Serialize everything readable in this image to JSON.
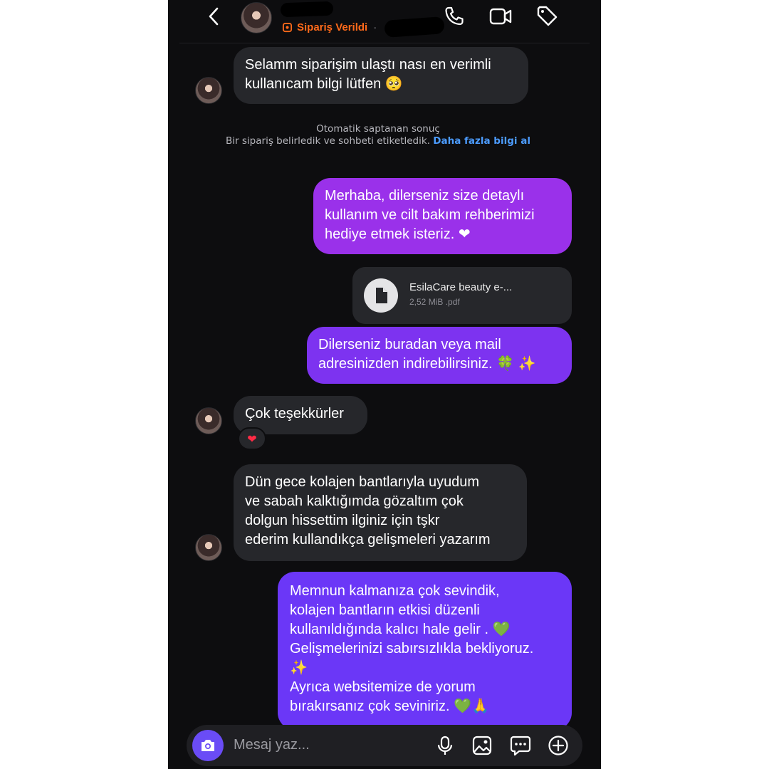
{
  "header": {
    "order_status": "Sipariş Verildi",
    "separator": "·"
  },
  "messages": [
    {
      "sender": "customer",
      "text": "Selamm siparişim ulaştı nası en verimli\nkullanıcam bilgi lütfen 🥺"
    },
    {
      "sender": "shop",
      "text": "Merhaba, dilerseniz size detaylı\nkullanım ve cilt bakım rehberimizi\nhediye etmek isteriz. ❤"
    },
    {
      "sender": "shop",
      "text": "Dilerseniz buradan veya mail\nadresinizden indirebilirsiniz. 🍀 ✨"
    },
    {
      "sender": "customer",
      "text": "Çok teşekkürler"
    },
    {
      "sender": "customer",
      "text": "Dün gece kolajen bantlarıyla uyudum\nve sabah kalktığımda gözaltım çok\ndolgun hissettim ilginiz için tşkr\nederim kullandıkça gelişmeleri yazarım"
    },
    {
      "sender": "shop",
      "text": "Memnun kalmanıza çok sevindik,\nkolajen bantların etkisi düzenli\nkullanıldığında kalıcı hale gelir . 💚\nGelişmelerinizi sabırsızlıkla bekliyoruz.\n✨\nAyrıca websitemize de yorum\nbırakırsanız çok seviniriz. 💚🙏"
    }
  ],
  "auto_notice": {
    "line1": "Otomatik saptanan sonuç",
    "line2": "Bir sipariş belirledik ve sohbeti etiketledik.",
    "link": "Daha fazla bilgi al"
  },
  "file": {
    "name": "EsilaCare beauty e-...",
    "meta": "2,52 MiB .pdf"
  },
  "reaction": "❤",
  "composer": {
    "placeholder": "Mesaj yaz..."
  },
  "icons": [
    "back-icon",
    "phone-icon",
    "video-icon",
    "tag-icon",
    "camera-icon",
    "mic-icon",
    "gallery-icon",
    "sticker-icon",
    "plus-icon",
    "document-icon"
  ],
  "colors": {
    "background": "#0d0d0f",
    "incoming_bubble": "#26272b",
    "outgoing_top": "#9a31ea",
    "outgoing_bottom": "#6b37f7",
    "order_accent": "#ff6a1a",
    "link": "#4c9cff"
  }
}
